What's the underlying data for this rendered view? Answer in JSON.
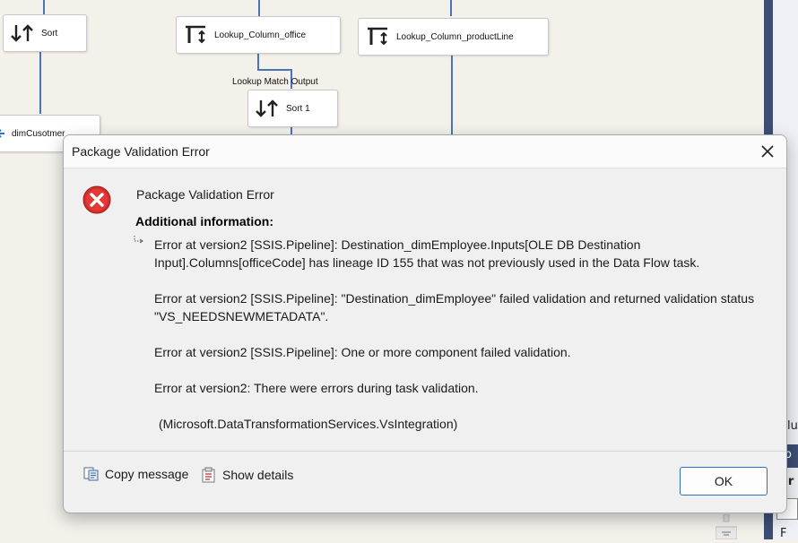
{
  "canvas": {
    "components": {
      "sort": "Sort",
      "lookup_office": "Lookup_Column_office",
      "lookup_productline": "Lookup_Column_productLine",
      "dim_customer": "dimCusotmer",
      "sort1": "Sort 1"
    },
    "path_label": "Lookup Match Output",
    "right_panel": {
      "label_1": "olu",
      "label_2": "ro",
      "label_3": "er",
      "label_4": "F"
    }
  },
  "dialog": {
    "title": "Package Validation Error",
    "heading": "Package Validation Error",
    "additional_info_label": "Additional information:",
    "messages": [
      "Error at version2 [SSIS.Pipeline]: Destination_dimEmployee.Inputs[OLE DB Destination Input].Columns[officeCode] has lineage ID 155 that was not previously used in the Data Flow task.",
      "Error at version2 [SSIS.Pipeline]: \"Destination_dimEmployee\" failed validation and returned validation status \"VS_NEEDSNEWMETADATA\".",
      "Error at version2 [SSIS.Pipeline]: One or more component failed validation.",
      "Error at version2: There were errors during task validation.",
      "(Microsoft.DataTransformationServices.VsIntegration)"
    ],
    "copy_message_label": "Copy message",
    "show_details_label": "Show details",
    "ok_label": "OK"
  },
  "colors": {
    "connector": "#4a74b8",
    "error_red": "#c62828",
    "accent_border": "#2f6fb8"
  }
}
